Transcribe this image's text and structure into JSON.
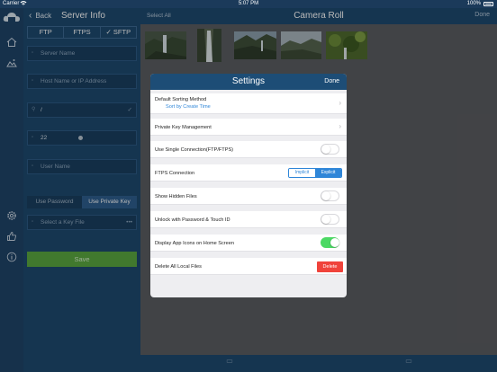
{
  "status_bar": {
    "carrier": "Carrier",
    "wifi_icon": "wifi-icon",
    "time": "5:07 PM",
    "battery": "100%"
  },
  "rail": {
    "icons": [
      "app-logo-icon",
      "home-icon",
      "image-icon",
      "gear-icon",
      "thumbs-up-icon",
      "info-icon"
    ]
  },
  "server_info": {
    "back_label": "Back",
    "title": "Server Info",
    "protocols": [
      {
        "label": "FTP",
        "selected": false
      },
      {
        "label": "FTPS",
        "selected": false
      },
      {
        "label": "SFTP",
        "selected": true
      }
    ],
    "server_name_placeholder": "Server Name",
    "host_placeholder": "Host Name or IP Address",
    "path_value": "/",
    "port_value": "22",
    "username_placeholder": "User Name",
    "auth_options": [
      {
        "label": "Use Password",
        "selected": false
      },
      {
        "label": "Use Private Key",
        "selected": true
      }
    ],
    "key_file_placeholder": "Select a Key File",
    "key_file_more": "•••",
    "save_label": "Save"
  },
  "camera_roll": {
    "select_all": "Select All",
    "title": "Camera Roll",
    "done": "Done"
  },
  "settings": {
    "title": "Settings",
    "done": "Done",
    "sorting_label": "Default Sorting Method",
    "sorting_value": "Sort by Create Time",
    "private_key_label": "Private Key Management",
    "single_connection_label": "Use Single Connection(FTP/FTPS)",
    "single_connection_on": false,
    "ftps_connection_label": "FTPS Connection",
    "ftps_options": [
      {
        "label": "Implicit",
        "selected": false
      },
      {
        "label": "Explicit",
        "selected": true
      }
    ],
    "show_hidden_label": "Show Hidden Files",
    "show_hidden_on": false,
    "unlock_label": "Unlock with Password & Touch ID",
    "unlock_on": false,
    "display_icons_label": "Display App Icons on Home Screen",
    "display_icons_on": true,
    "delete_label": "Delete All Local Files",
    "delete_button": "Delete"
  },
  "colors": {
    "panel": "#1e4a70",
    "accent_blue": "#2f86d8",
    "toggle_on": "#4cd964",
    "danger": "#f0433b",
    "save_green": "#5aa840"
  }
}
